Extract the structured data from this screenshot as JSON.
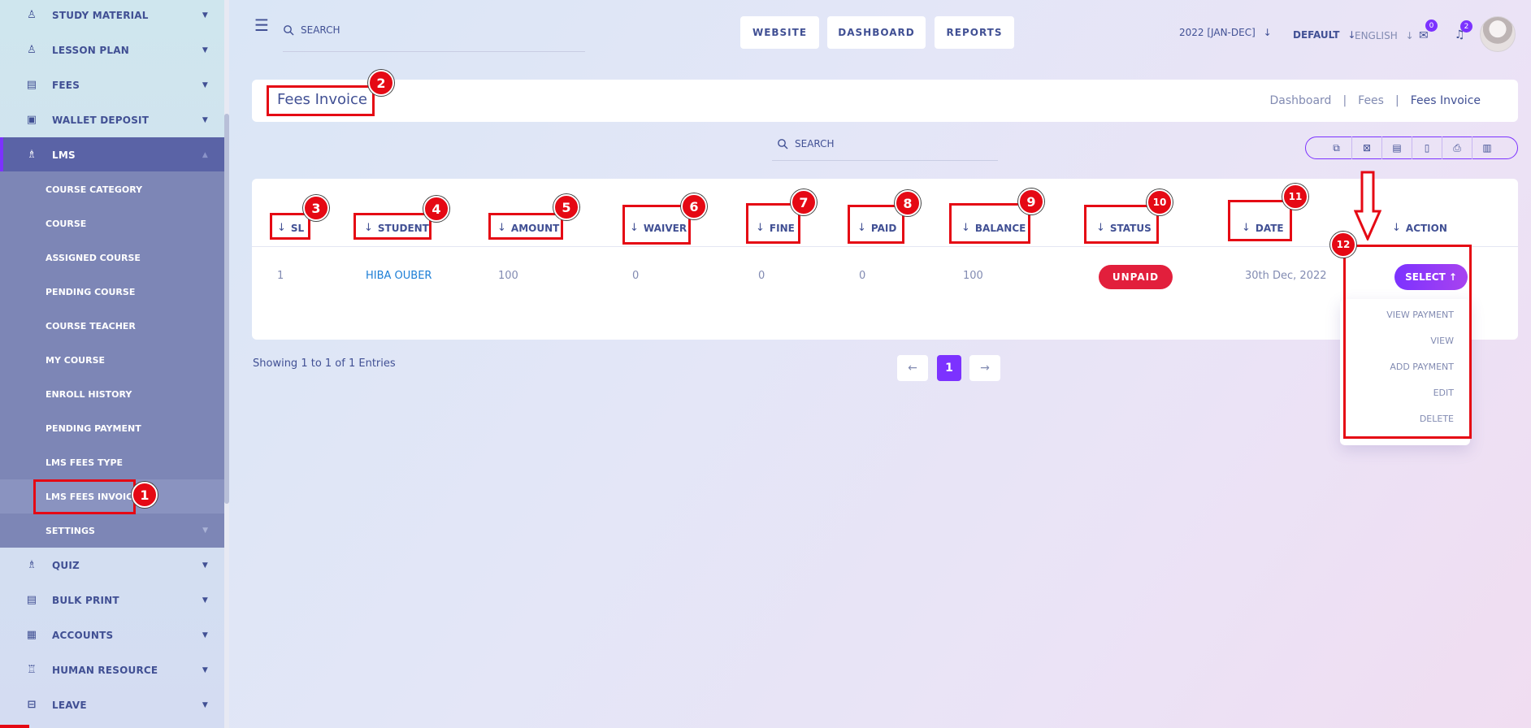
{
  "sidebar": {
    "items_top": [
      {
        "label": "STUDY MATERIAL",
        "icon": "book-reader-icon"
      },
      {
        "label": "LESSON PLAN",
        "icon": "book-reader-icon"
      },
      {
        "label": "FEES",
        "icon": "receipt-icon"
      },
      {
        "label": "WALLET DEPOSIT",
        "icon": "wallet-icon"
      }
    ],
    "active_item": {
      "label": "LMS",
      "icon": "graduate-icon"
    },
    "submenu": [
      "COURSE CATEGORY",
      "COURSE",
      "ASSIGNED COURSE",
      "PENDING COURSE",
      "COURSE TEACHER",
      "MY COURSE",
      "ENROLL HISTORY",
      "PENDING PAYMENT",
      "LMS FEES TYPE",
      "LMS FEES INVOICE",
      "SETTINGS"
    ],
    "items_bottom": [
      {
        "label": "QUIZ",
        "icon": "graduate-icon"
      },
      {
        "label": "BULK PRINT",
        "icon": "print-doc-icon"
      },
      {
        "label": "ACCOUNTS",
        "icon": "accounts-icon"
      },
      {
        "label": "HUMAN RESOURCE",
        "icon": "people-icon"
      },
      {
        "label": "LEAVE",
        "icon": "bed-icon"
      }
    ]
  },
  "topbar": {
    "search_placeholder": "SEARCH",
    "buttons": [
      "WEBSITE",
      "DASHBOARD",
      "REPORTS"
    ],
    "session": "2022 [JAN-DEC]",
    "theme": "DEFAULT",
    "language": "ENGLISH",
    "chat_count": "0",
    "notification_count": "2"
  },
  "page": {
    "title": "Fees Invoice",
    "breadcrumb": [
      "Dashboard",
      "Fees",
      "Fees Invoice"
    ]
  },
  "table": {
    "search_placeholder": "SEARCH",
    "export_icons": [
      "copy-icon",
      "excel-icon",
      "csv-icon",
      "pdf-icon",
      "print-icon",
      "columns-icon"
    ],
    "columns": [
      "SL",
      "STUDENT",
      "AMOUNT",
      "WAIVER",
      "FINE",
      "PAID",
      "BALANCE",
      "STATUS",
      "DATE",
      "ACTION"
    ],
    "rows": [
      {
        "sl": "1",
        "student": "HIBA OUBER",
        "amount": "100",
        "waiver": "0",
        "fine": "0",
        "paid": "0",
        "balance": "100",
        "status": "UNPAID",
        "date": "30th Dec, 2022",
        "action": "SELECT"
      }
    ],
    "action_menu": [
      "VIEW PAYMENT",
      "VIEW",
      "ADD PAYMENT",
      "EDIT",
      "DELETE"
    ],
    "footer_text": "Showing 1 to 1 of 1 Entries",
    "pagination": {
      "prev": "←",
      "current": "1",
      "next": "→"
    }
  },
  "annotations": [
    "1",
    "2",
    "3",
    "4",
    "5",
    "6",
    "7",
    "8",
    "9",
    "10",
    "11",
    "12"
  ],
  "colors": {
    "accent": "#7c32ff",
    "annotation": "#e50914",
    "status_unpaid": "#e21f3c",
    "sidebar_active": "#5a63a6",
    "submenu_bg": "#7d86b6",
    "link": "#1c7ed6"
  }
}
